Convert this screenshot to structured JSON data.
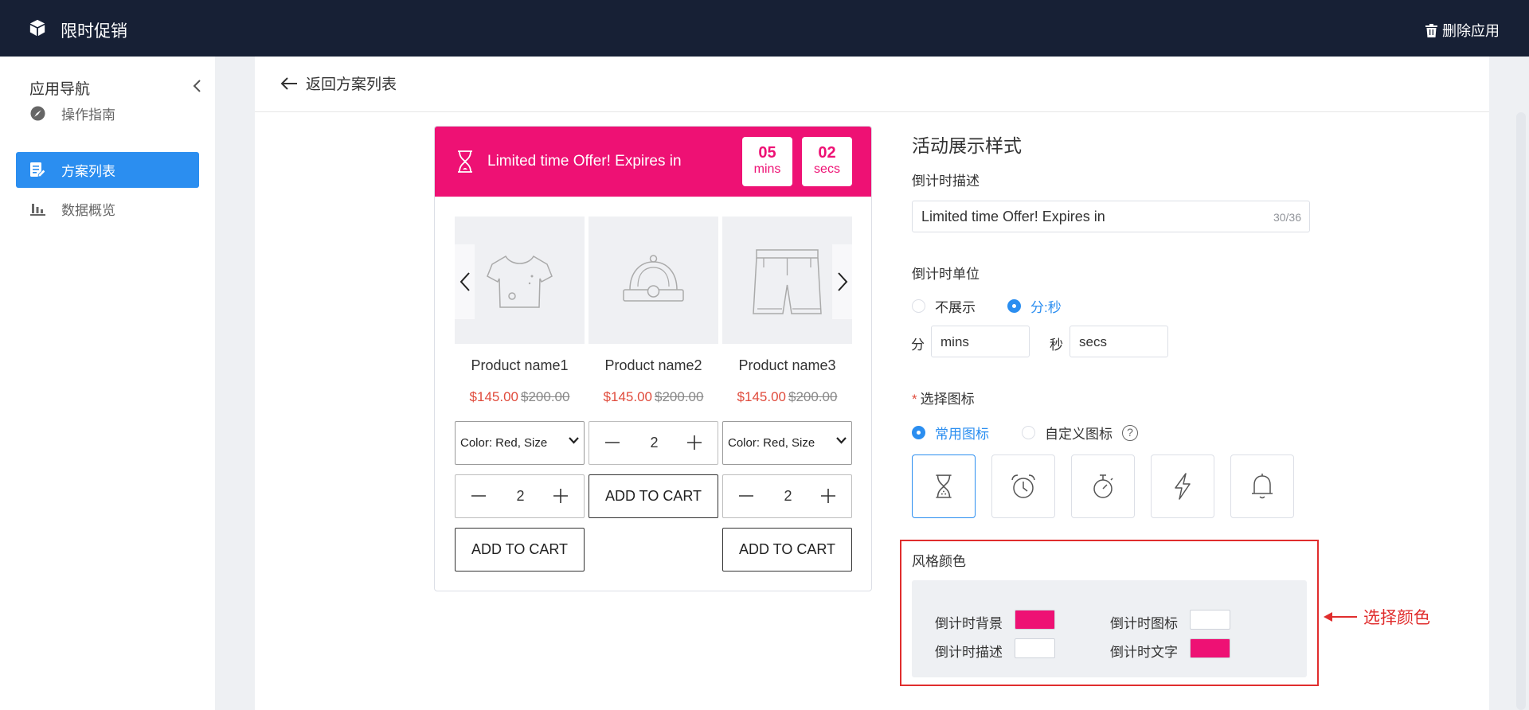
{
  "header": {
    "title": "限时促销",
    "delete_label": "删除应用"
  },
  "sidebar": {
    "title": "应用导航",
    "items": [
      {
        "label": "操作指南",
        "icon": "navigation-icon"
      },
      {
        "label": "方案列表",
        "icon": "document-edit-icon",
        "active": true
      },
      {
        "label": "数据概览",
        "icon": "bar-chart-icon"
      }
    ]
  },
  "main": {
    "back_label": "返回方案列表"
  },
  "preview": {
    "banner_text": "Limited time Offer! Expires in",
    "banner_color": "#ee1174",
    "timer": [
      {
        "num": "05",
        "unit": "mins"
      },
      {
        "num": "02",
        "unit": "secs"
      }
    ],
    "products": [
      {
        "name": "Product name1",
        "price": "$145.00",
        "was": "$200.00",
        "icon": "t-shirt-icon"
      },
      {
        "name": "Product name2",
        "price": "$145.00",
        "was": "$200.00",
        "icon": "cap-icon"
      },
      {
        "name": "Product name3",
        "price": "$145.00",
        "was": "$200.00",
        "icon": "shorts-icon"
      }
    ],
    "variant_label": "Color: Red, Size",
    "qty": "2",
    "add_to_cart": "ADD TO CART"
  },
  "settings": {
    "section_title": "活动展示样式",
    "desc_label": "倒计时描述",
    "desc_value": "Limited time Offer! Expires in",
    "desc_count": "30/36",
    "unit_label": "倒计时单位",
    "unit_options": [
      "不展示",
      "分:秒"
    ],
    "unit_selected": "分:秒",
    "min_label": "分",
    "min_value": "mins",
    "sec_label": "秒",
    "sec_value": "secs",
    "icon_label": "选择图标",
    "icon_required": "*",
    "icon_options": [
      "常用图标",
      "自定义图标"
    ],
    "help_mark": "?",
    "icons": [
      "hourglass-icon",
      "alarm-clock-icon",
      "stopwatch-icon",
      "lightning-icon",
      "bell-icon"
    ],
    "style_color": {
      "title": "风格颜色",
      "bg_label": "倒计时背景",
      "bg_color": "#ee1174",
      "icon_color_label": "倒计时图标",
      "icon_color": "#ffffff",
      "desc_color_label": "倒计时描述",
      "desc_color": "#ffffff",
      "text_color_label": "倒计时文字",
      "text_color": "#ee1174"
    }
  },
  "annotation": {
    "text": "选择颜色",
    "color": "#e02d2d"
  }
}
